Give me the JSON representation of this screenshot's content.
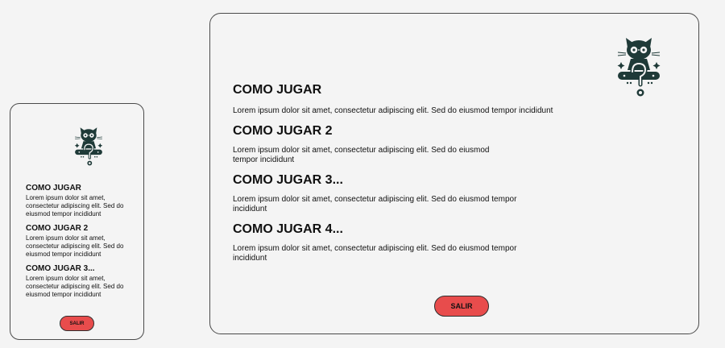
{
  "logo": {
    "icon": "cat-question-icon"
  },
  "sections": [
    {
      "title": "COMO JUGAR",
      "text": "Lorem ipsum dolor sit amet, consectetur adipiscing elit. Sed do eiusmod tempor incididunt"
    },
    {
      "title": "COMO JUGAR 2",
      "text": "Lorem ipsum dolor sit amet, consectetur adipiscing elit. Sed do eiusmod tempor incididunt"
    },
    {
      "title": "COMO JUGAR 3...",
      "text": "Lorem ipsum dolor sit amet, consectetur adipiscing elit. Sed do eiusmod tempor incididunt"
    },
    {
      "title": "COMO JUGAR 4...",
      "text": "Lorem ipsum dolor sit amet, consectetur adipiscing elit. Sed do eiusmod tempor incididunt"
    }
  ],
  "exit_button": {
    "label": "SALIR"
  },
  "colors": {
    "accent": "#e84c4c",
    "background": "#f4f4f4",
    "logo": "#1f3a38",
    "border": "#4a4a4a"
  }
}
